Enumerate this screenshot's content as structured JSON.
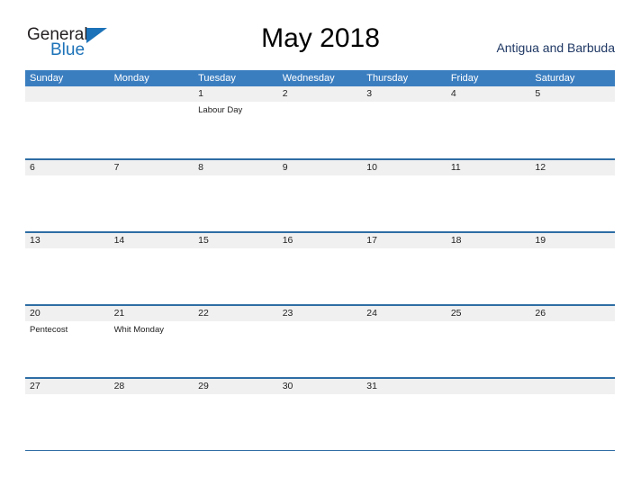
{
  "brand": {
    "name_line1": "General",
    "name_line2": "Blue",
    "flag_icon": "blue-triangle-flag",
    "color_dark": "#231f20",
    "color_blue": "#1c72b8"
  },
  "header": {
    "title": "May 2018",
    "location": "Antigua and Barbuda"
  },
  "theme": {
    "header_blue": "#3b7ec0",
    "divider_blue": "#2e6da4",
    "band_gray": "#f0f0f0",
    "text_dark": "#222222",
    "location_color": "#1f3864"
  },
  "calendar": {
    "month": "May",
    "year": "2018",
    "weekdays": [
      "Sunday",
      "Monday",
      "Tuesday",
      "Wednesday",
      "Thursday",
      "Friday",
      "Saturday"
    ],
    "weeks": [
      [
        {
          "date": "",
          "events": []
        },
        {
          "date": "",
          "events": []
        },
        {
          "date": "1",
          "events": [
            "Labour Day"
          ]
        },
        {
          "date": "2",
          "events": []
        },
        {
          "date": "3",
          "events": []
        },
        {
          "date": "4",
          "events": []
        },
        {
          "date": "5",
          "events": []
        }
      ],
      [
        {
          "date": "6",
          "events": []
        },
        {
          "date": "7",
          "events": []
        },
        {
          "date": "8",
          "events": []
        },
        {
          "date": "9",
          "events": []
        },
        {
          "date": "10",
          "events": []
        },
        {
          "date": "11",
          "events": []
        },
        {
          "date": "12",
          "events": []
        }
      ],
      [
        {
          "date": "13",
          "events": []
        },
        {
          "date": "14",
          "events": []
        },
        {
          "date": "15",
          "events": []
        },
        {
          "date": "16",
          "events": []
        },
        {
          "date": "17",
          "events": []
        },
        {
          "date": "18",
          "events": []
        },
        {
          "date": "19",
          "events": []
        }
      ],
      [
        {
          "date": "20",
          "events": [
            "Pentecost"
          ]
        },
        {
          "date": "21",
          "events": [
            "Whit Monday"
          ]
        },
        {
          "date": "22",
          "events": []
        },
        {
          "date": "23",
          "events": []
        },
        {
          "date": "24",
          "events": []
        },
        {
          "date": "25",
          "events": []
        },
        {
          "date": "26",
          "events": []
        }
      ],
      [
        {
          "date": "27",
          "events": []
        },
        {
          "date": "28",
          "events": []
        },
        {
          "date": "29",
          "events": []
        },
        {
          "date": "30",
          "events": []
        },
        {
          "date": "31",
          "events": []
        },
        {
          "date": "",
          "events": []
        },
        {
          "date": "",
          "events": []
        }
      ]
    ]
  }
}
